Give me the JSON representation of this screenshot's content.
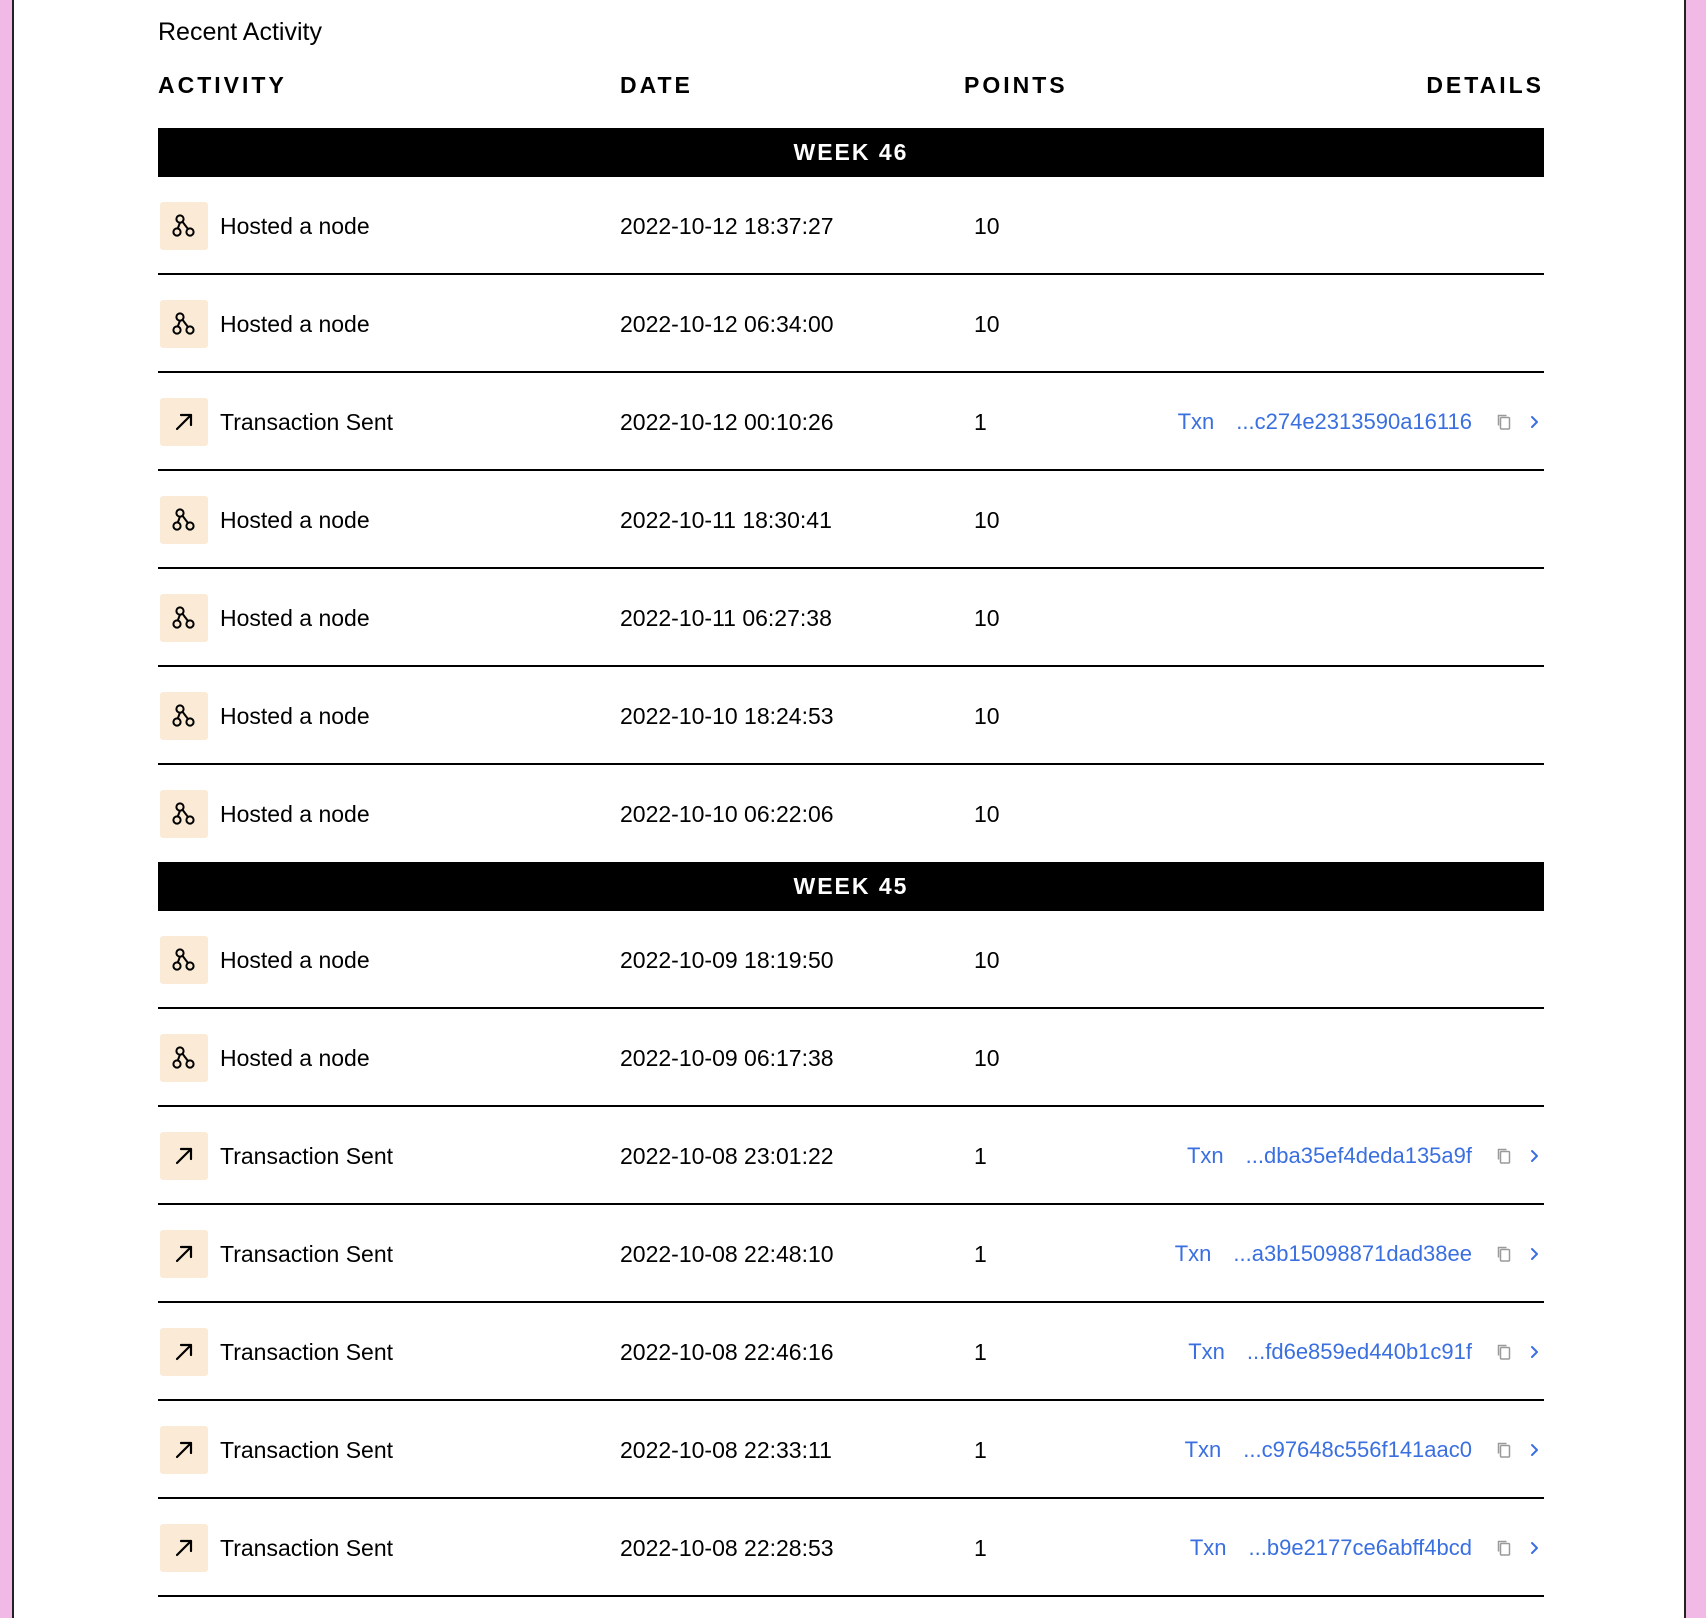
{
  "title": "Recent Activity",
  "columns": {
    "activity": "ACTIVITY",
    "date": "DATE",
    "points": "POINTS",
    "details": "DETAILS"
  },
  "colors": {
    "icon_bg": "#fbebd6",
    "link": "#3a6fe0",
    "page_bg": "#f1b9e6"
  },
  "weeks": [
    {
      "label": "WEEK 46",
      "rows": [
        {
          "type": "node",
          "icon": "node-icon",
          "label": "Hosted a node",
          "date": "2022-10-12 18:37:27",
          "points": "10"
        },
        {
          "type": "node",
          "icon": "node-icon",
          "label": "Hosted a node",
          "date": "2022-10-12 06:34:00",
          "points": "10"
        },
        {
          "type": "txn",
          "icon": "arrow-up-right-icon",
          "label": "Transaction Sent",
          "date": "2022-10-12 00:10:26",
          "points": "1",
          "txn_label": "Txn",
          "hash": "...c274e2313590a16116"
        },
        {
          "type": "node",
          "icon": "node-icon",
          "label": "Hosted a node",
          "date": "2022-10-11 18:30:41",
          "points": "10"
        },
        {
          "type": "node",
          "icon": "node-icon",
          "label": "Hosted a node",
          "date": "2022-10-11 06:27:38",
          "points": "10"
        },
        {
          "type": "node",
          "icon": "node-icon",
          "label": "Hosted a node",
          "date": "2022-10-10 18:24:53",
          "points": "10"
        },
        {
          "type": "node",
          "icon": "node-icon",
          "label": "Hosted a node",
          "date": "2022-10-10 06:22:06",
          "points": "10"
        }
      ]
    },
    {
      "label": "WEEK 45",
      "rows": [
        {
          "type": "node",
          "icon": "node-icon",
          "label": "Hosted a node",
          "date": "2022-10-09 18:19:50",
          "points": "10"
        },
        {
          "type": "node",
          "icon": "node-icon",
          "label": "Hosted a node",
          "date": "2022-10-09 06:17:38",
          "points": "10"
        },
        {
          "type": "txn",
          "icon": "arrow-up-right-icon",
          "label": "Transaction Sent",
          "date": "2022-10-08 23:01:22",
          "points": "1",
          "txn_label": "Txn",
          "hash": "...dba35ef4deda135a9f"
        },
        {
          "type": "txn",
          "icon": "arrow-up-right-icon",
          "label": "Transaction Sent",
          "date": "2022-10-08 22:48:10",
          "points": "1",
          "txn_label": "Txn",
          "hash": "...a3b15098871dad38ee"
        },
        {
          "type": "txn",
          "icon": "arrow-up-right-icon",
          "label": "Transaction Sent",
          "date": "2022-10-08 22:46:16",
          "points": "1",
          "txn_label": "Txn",
          "hash": "...fd6e859ed440b1c91f"
        },
        {
          "type": "txn",
          "icon": "arrow-up-right-icon",
          "label": "Transaction Sent",
          "date": "2022-10-08 22:33:11",
          "points": "1",
          "txn_label": "Txn",
          "hash": "...c97648c556f141aac0"
        },
        {
          "type": "txn",
          "icon": "arrow-up-right-icon",
          "label": "Transaction Sent",
          "date": "2022-10-08 22:28:53",
          "points": "1",
          "txn_label": "Txn",
          "hash": "...b9e2177ce6abff4bcd"
        }
      ]
    }
  ]
}
